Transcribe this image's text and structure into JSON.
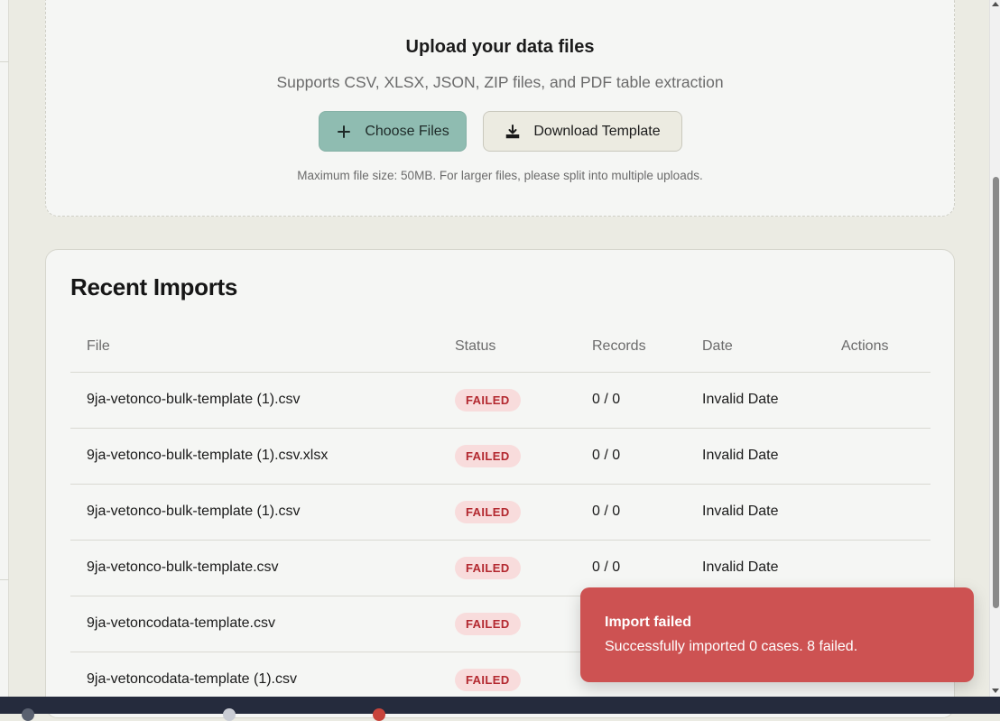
{
  "upload": {
    "title": "Upload your data files",
    "subtitle": "Supports CSV, XLSX, JSON, ZIP files, and PDF table extraction",
    "choose_label": "Choose Files",
    "choose_icon": "plus-icon",
    "template_label": "Download Template",
    "template_icon": "download-icon",
    "note": "Maximum file size: 50MB. For larger files, please split into multiple uploads."
  },
  "recent": {
    "title": "Recent Imports",
    "columns": [
      "File",
      "Status",
      "Records",
      "Date",
      "Actions"
    ],
    "rows": [
      {
        "file": "9ja-vetonco-bulk-template (1).csv",
        "status": "FAILED",
        "records": "0 / 0",
        "date": "Invalid Date"
      },
      {
        "file": "9ja-vetonco-bulk-template (1).csv.xlsx",
        "status": "FAILED",
        "records": "0 / 0",
        "date": "Invalid Date"
      },
      {
        "file": "9ja-vetonco-bulk-template (1).csv",
        "status": "FAILED",
        "records": "0 / 0",
        "date": "Invalid Date"
      },
      {
        "file": "9ja-vetonco-bulk-template.csv",
        "status": "FAILED",
        "records": "0 / 0",
        "date": "Invalid Date"
      },
      {
        "file": "9ja-vetoncodata-template.csv",
        "status": "FAILED",
        "records": "",
        "date": ""
      },
      {
        "file": "9ja-vetoncodata-template (1).csv",
        "status": "FAILED",
        "records": "",
        "date": ""
      }
    ]
  },
  "toast": {
    "title": "Import failed",
    "message": "Successfully imported 0 cases. 8 failed."
  },
  "colors": {
    "accent": "#8fbcb1",
    "failed_badge_bg": "#f8dcdc",
    "failed_badge_text": "#b3282f",
    "toast_bg": "#cd5252"
  }
}
